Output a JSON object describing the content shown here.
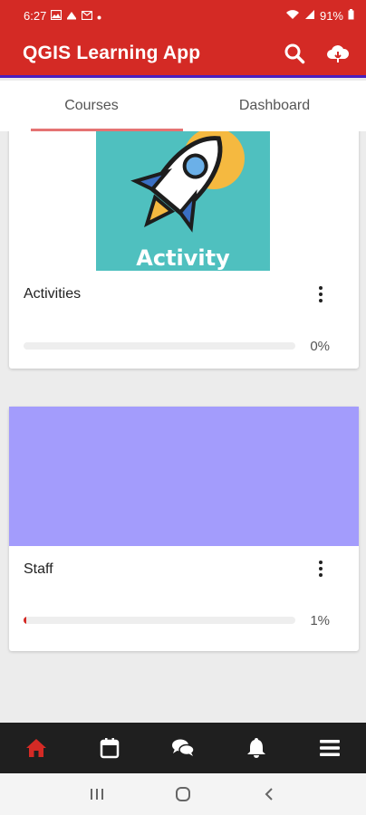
{
  "status_bar": {
    "time": "6:27",
    "battery": "91%"
  },
  "app_bar": {
    "title": "QGIS Learning App",
    "search_icon": "search-icon",
    "cloud_icon": "cloud-download-icon"
  },
  "tabs": [
    {
      "label": "Courses",
      "active": true
    },
    {
      "label": "Dashboard",
      "active": false
    }
  ],
  "courses": [
    {
      "title": "Activities",
      "image_text": "Activity",
      "image_bg": "#4fc0bf",
      "progress": 0,
      "progress_label": "0%"
    },
    {
      "title": "Staff",
      "image_bg": "#a39cfc",
      "progress": 0.01,
      "progress_label": "1%"
    }
  ],
  "bottom_nav": [
    {
      "icon": "home-icon",
      "active": true
    },
    {
      "icon": "calendar-icon",
      "active": false
    },
    {
      "icon": "chat-icon",
      "active": false
    },
    {
      "icon": "bell-icon",
      "active": false
    },
    {
      "icon": "menu-icon",
      "active": false
    }
  ],
  "colors": {
    "primary": "#d42a25",
    "accent_underline": "#e57373",
    "nav_bg": "#1f1f1f"
  }
}
